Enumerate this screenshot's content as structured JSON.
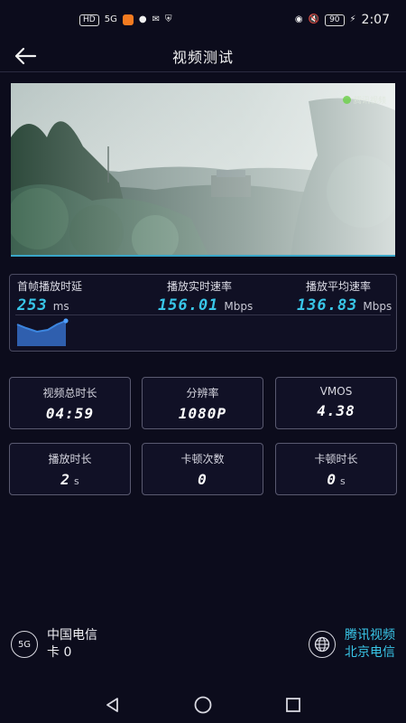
{
  "status_bar": {
    "time": "2:07",
    "battery": "90",
    "network": "5G",
    "hd_label": "HD"
  },
  "header": {
    "title": "视频测试",
    "back_icon": "arrow-left-icon"
  },
  "video": {
    "watermark": "腾讯视频"
  },
  "speed_panel": {
    "first_frame": {
      "label": "首帧播放时延",
      "value": "253",
      "unit": "ms"
    },
    "realtime": {
      "label": "播放实时速率",
      "value": "156.01",
      "unit": "Mbps"
    },
    "average": {
      "label": "播放平均速率",
      "value": "136.83",
      "unit": "Mbps"
    }
  },
  "stats": {
    "total_duration": {
      "label": "视频总时长",
      "value": "04:59"
    },
    "resolution": {
      "label": "分辨率",
      "value": "1080P"
    },
    "vmos": {
      "label": "VMOS",
      "value": "4.38"
    },
    "play_duration": {
      "label": "播放时长",
      "value": "2",
      "unit": "s"
    },
    "stall_count": {
      "label": "卡顿次数",
      "value": "0"
    },
    "stall_duration": {
      "label": "卡顿时长",
      "value": "0",
      "unit": "s"
    }
  },
  "network_info": {
    "badge": "5G",
    "carrier": "中国电信",
    "sim": "卡 0"
  },
  "source_info": {
    "icon": "globe-icon",
    "platform": "腾讯视频",
    "location": "北京电信"
  },
  "colors": {
    "accent": "#39c6e8",
    "background": "#0c0c1c",
    "sparkline_fill": "#2f5fae"
  }
}
